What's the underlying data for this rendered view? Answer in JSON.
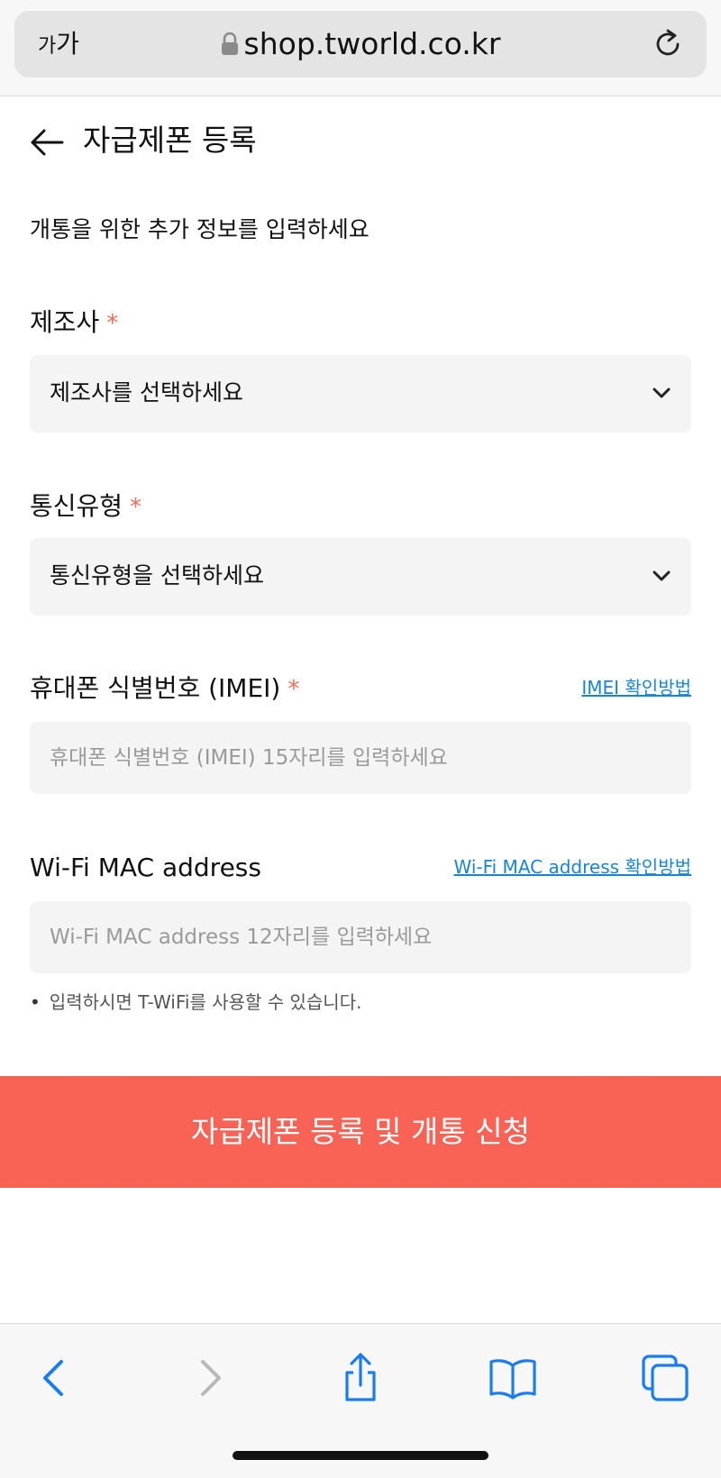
{
  "browser": {
    "text_size_small": "가",
    "text_size_large": "가",
    "url": "shop.tworld.co.kr"
  },
  "header": {
    "title": "자급제폰 등록"
  },
  "intro": "개통을 위한 추가 정보를 입력하세요",
  "form": {
    "required_mark": "*",
    "manufacturer": {
      "label": "제조사",
      "selected": "제조사를 선택하세요"
    },
    "network_type": {
      "label": "통신유형",
      "selected": "통신유형을 선택하세요"
    },
    "imei": {
      "label": "휴대폰 식별번호 (IMEI)",
      "help_link": "IMEI 확인방법",
      "placeholder": "휴대폰 식별번호 (IMEI) 15자리를 입력하세요",
      "value": ""
    },
    "wifi_mac": {
      "label": "Wi-Fi MAC address",
      "help_link": "Wi-Fi MAC address 확인방법",
      "placeholder": "Wi-Fi MAC address 12자리를 입력하세요",
      "value": ""
    },
    "note": "입력하시면 T-WiFi를 사용할 수 있습니다.",
    "bullet": "•"
  },
  "submit": {
    "label": "자급제폰 등록 및 개통 신청"
  },
  "colors": {
    "accent": "#f86356",
    "required": "#f26b5b",
    "link": "#1a84d4",
    "ios_blue": "#1a7cf0"
  },
  "toolbar_icons": [
    "chevron-left-icon",
    "chevron-right-icon",
    "share-icon",
    "bookmarks-icon",
    "tabs-icon"
  ]
}
